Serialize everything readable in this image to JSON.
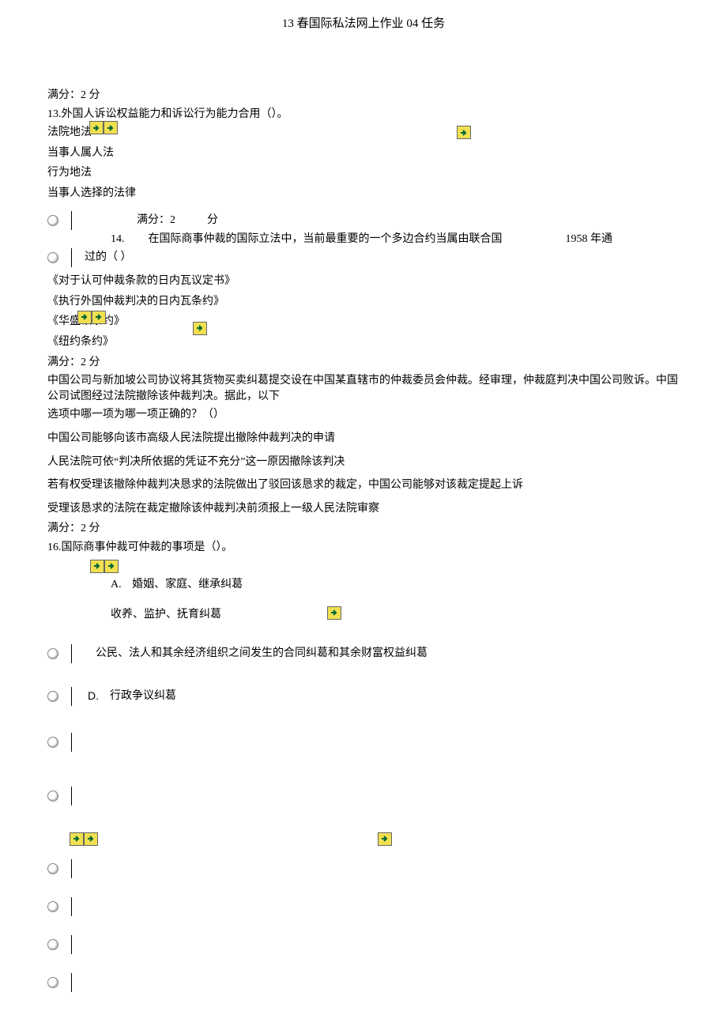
{
  "header": "13 春国际私法网上作业 04 任务",
  "q13": {
    "score": "满分：2 分",
    "stem": "13.外国人诉讼权益能力和诉讼行为能力合用（）。",
    "opts": [
      "法院地法",
      "当事人属人法",
      "行为地法",
      "当事人选择的法律"
    ]
  },
  "q14": {
    "score_l": "满分：2",
    "score_r": "分",
    "num": "14.",
    "stem_a": "在国际商事仲裁的国际立法中，当前最重要的一个多边合约当属由联合国",
    "stem_year": "1958 年通",
    "stem_b": "过的（      ）",
    "opts": [
      "《对于认可仲裁条款的日内瓦议定书》",
      "《执行外国仲裁判决的日内瓦条约》",
      "《华盛顿条约》",
      "《纽约条约》"
    ]
  },
  "q15": {
    "score": "满分：2 分",
    "stem1": "中国公司与新加坡公司协议将其货物买卖纠葛提交设在中国某直辖市的仲裁委员会仲裁。经审理，仲裁庭判决中国公司败诉。中国公司试图经过法院撤除该仲裁判决。据此，以下",
    "stem2": "选项中哪一项为哪一项正确的？（）",
    "opts": [
      "中国公司能够向该市高级人民法院提出撤除仲裁判决的申请",
      "人民法院可依“判决所依据的凭证不充分”这一原因撤除该判决",
      "若有权受理该撤除仲裁判决恳求的法院做出了驳回该恳求的裁定，中国公司能够对该裁定提起上诉",
      "受理该恳求的法院在裁定撤除该仲裁判决前须报上一级人民法院审察"
    ]
  },
  "q16": {
    "score": "满分：2 分",
    "stem": "16.国际商事仲裁可仲裁的事项是（）。",
    "optA_pre": "A.",
    "optA": "婚姻、家庭、继承纠葛",
    "optB": "收养、监护、抚育纠葛",
    "optC": "公民、法人和其余经济组织之间发生的合同纠葛和其余财富权益纠葛",
    "optD_pre": "D.",
    "optD": "行政争议纠葛"
  }
}
